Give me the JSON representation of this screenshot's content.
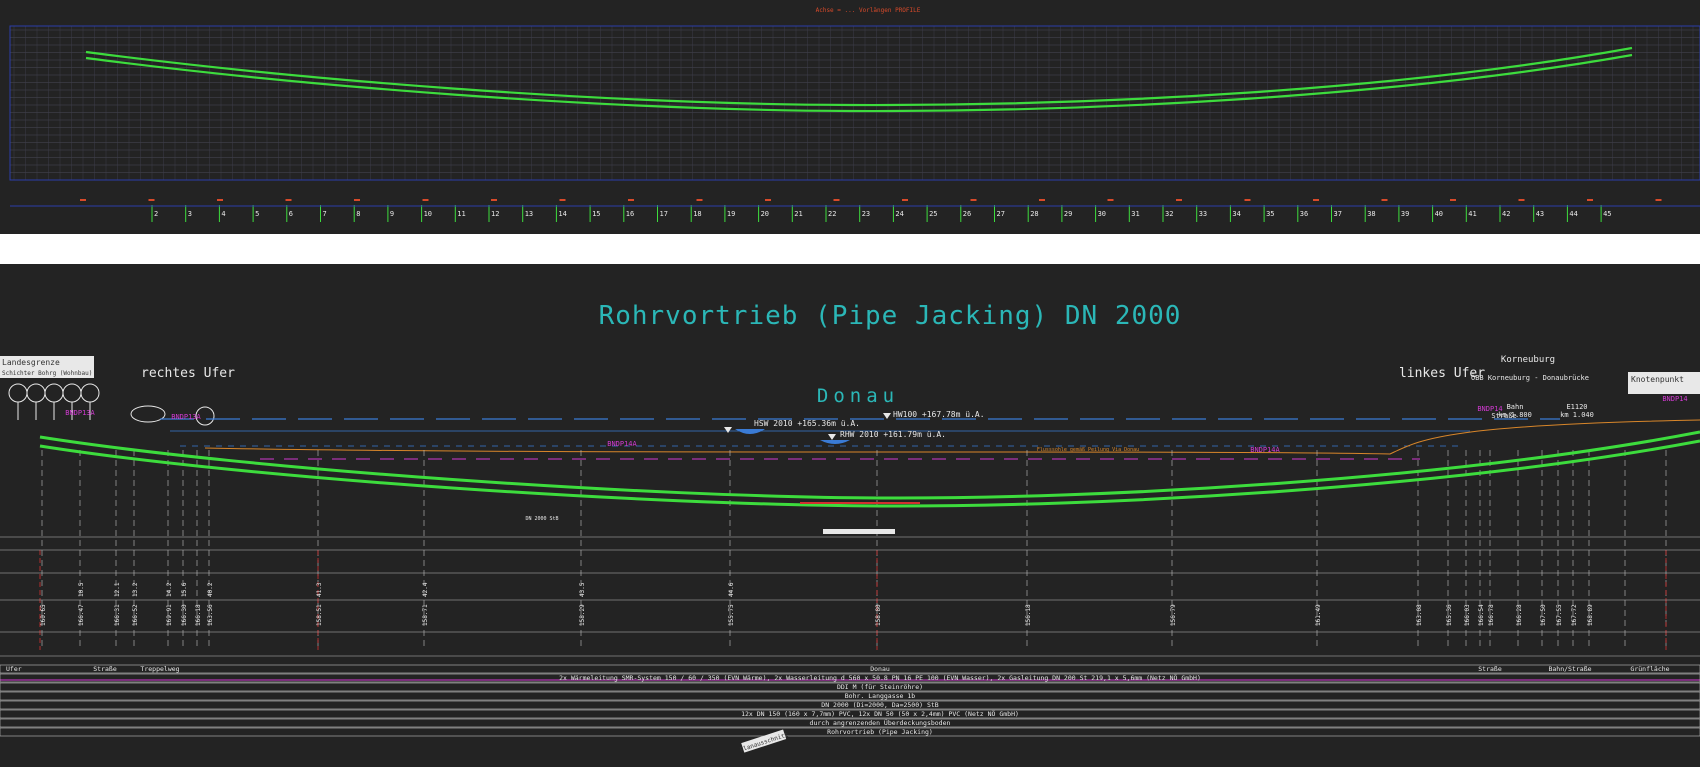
{
  "colors": {
    "background": "#232323",
    "pipe_green": "#3ddc3d",
    "grid": "#4a4a58",
    "frame_blue": "#2b3ea8",
    "title_cyan": "#2bb7b7",
    "magenta": "#d23ad2",
    "water_blue": "#3a7bd5",
    "label_white": "#e8e8e8",
    "red": "#d33030",
    "orange": "#d8862a"
  },
  "top_panel": {
    "header": "Achse = ... Vorlängen PROFILE",
    "station_numbers": [
      "2",
      "3",
      "4",
      "5",
      "6",
      "7",
      "8",
      "9",
      "10",
      "11",
      "12",
      "13",
      "14",
      "15",
      "16",
      "17",
      "18",
      "19",
      "20",
      "21",
      "22",
      "23",
      "24",
      "25",
      "26",
      "27",
      "28",
      "29",
      "30",
      "31",
      "32",
      "33",
      "34",
      "35",
      "36",
      "37",
      "38",
      "39",
      "40",
      "41",
      "42",
      "43",
      "44",
      "45"
    ]
  },
  "main": {
    "title": "Rohrvortrieb (Pipe Jacking) DN 2000",
    "river_label": "Donau",
    "right_bank": "rechtes Ufer",
    "left_bank": "linkes Ufer",
    "korneuburg": "Korneuburg",
    "oebb_label": "ÖBB Korneuburg - Donaubrücke",
    "bahn_label": "Bahn",
    "km_label": "km 1.800",
    "km2_label": "km 1.040",
    "e120_label": "E1120",
    "strasse_top": "Straße",
    "left_box": "Landesgrenze",
    "left_box_sub": "Schichter Bohrg (Wohnbau)",
    "right_box": "Knotenpunkt",
    "right_box_sub": "",
    "hsw_label": "HSW 2010 +165.36m ü.A.",
    "hw_label": "HW100 +167.78m ü.A.",
    "rhw_label": "RHW 2010 +161.79m ü.A.",
    "sohle_text": "Flusssohle gemäß Peilung Via Donau",
    "dn_text": "DN 2000 StB",
    "bndp_labels": [
      "BNDP13A",
      "BNDP13A",
      "BNDP14A",
      "BNDP14A",
      "BNDP14",
      "BNDP14"
    ],
    "top_elev_labels": [
      "10.5",
      "12.1",
      "13.2",
      "14.2",
      "15.6",
      "",
      "40.2",
      "41.3",
      "42.4",
      "43.5",
      "44.6"
    ],
    "bottom_elev_labels": [
      "160.65",
      "166.47",
      "166.31",
      "166.52",
      "169.91",
      "166.30",
      "166.18",
      "163.56",
      "158.51",
      "158.71",
      "158.29",
      "155.75",
      "158.80",
      "156.18",
      "156.79",
      "161.49",
      "163.08",
      "165.36",
      "166.03",
      "166.54",
      "166.78",
      "166.28",
      "167.50",
      "167.55",
      "167.72",
      "168.89"
    ]
  },
  "strip": {
    "row0": [
      "Ufer",
      "Straße",
      "Treppelweg",
      "Donau",
      "Straße",
      "Bahn/Straße",
      "Grünfläche"
    ],
    "row1": "2x Wärmeleitung  SMR-System 150 / 60 / 350 (EVN Wärme), 2x Wasserleitung  d 560 x 50.8  PN 16  PE 100 (EVN Wasser), 2x Gasleitung  DN 200 St 219,1 x 5,6mm (Netz NÖ GmbH)",
    "row2": "DDI M (für Steinröhre)",
    "row3": "Bohr. Langgasse 1b",
    "row4": "DN 2000 (Di=2000, Da=2500) StB",
    "row5": "12x DN 150 (160 x 7,7mm) PVC, 12x DN 50 (50 x 2,4mm) PVC (Netz NÖ GmbH)",
    "row6": "durch angrenzenden Überdeckungsboden",
    "row7": "Rohrvortrieb (Pipe Jacking)"
  },
  "note_label": "Planausschnitt"
}
